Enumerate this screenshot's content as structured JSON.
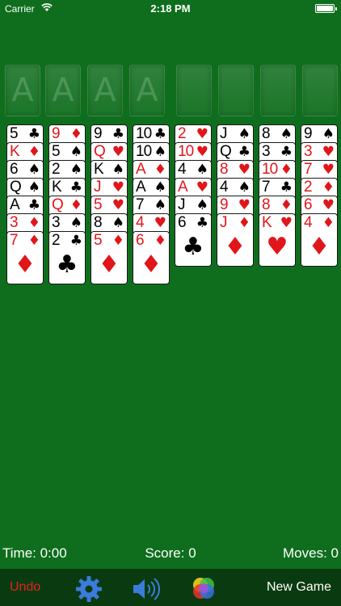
{
  "status_bar": {
    "carrier": "Carrier",
    "time": "2:18 PM"
  },
  "slots": [
    "A",
    "A",
    "A",
    "A",
    "",
    "",
    "",
    ""
  ],
  "columns": [
    [
      {
        "rank": "5",
        "suit": "♣",
        "color": "black"
      },
      {
        "rank": "K",
        "suit": "♦",
        "color": "red"
      },
      {
        "rank": "6",
        "suit": "♠",
        "color": "black"
      },
      {
        "rank": "Q",
        "suit": "♠",
        "color": "black"
      },
      {
        "rank": "A",
        "suit": "♣",
        "color": "black"
      },
      {
        "rank": "3",
        "suit": "♦",
        "color": "red"
      },
      {
        "rank": "7",
        "suit": "♦",
        "color": "red"
      }
    ],
    [
      {
        "rank": "9",
        "suit": "♦",
        "color": "red"
      },
      {
        "rank": "5",
        "suit": "♠",
        "color": "black"
      },
      {
        "rank": "2",
        "suit": "♠",
        "color": "black"
      },
      {
        "rank": "K",
        "suit": "♣",
        "color": "black"
      },
      {
        "rank": "Q",
        "suit": "♦",
        "color": "red"
      },
      {
        "rank": "3",
        "suit": "♠",
        "color": "black"
      },
      {
        "rank": "2",
        "suit": "♣",
        "color": "black"
      }
    ],
    [
      {
        "rank": "9",
        "suit": "♣",
        "color": "black"
      },
      {
        "rank": "Q",
        "suit": "♥",
        "color": "red"
      },
      {
        "rank": "K",
        "suit": "♠",
        "color": "black"
      },
      {
        "rank": "J",
        "suit": "♥",
        "color": "red"
      },
      {
        "rank": "5",
        "suit": "♥",
        "color": "red"
      },
      {
        "rank": "8",
        "suit": "♠",
        "color": "black"
      },
      {
        "rank": "5",
        "suit": "♦",
        "color": "red"
      }
    ],
    [
      {
        "rank": "10",
        "suit": "♣",
        "color": "black"
      },
      {
        "rank": "10",
        "suit": "♠",
        "color": "black"
      },
      {
        "rank": "A",
        "suit": "♦",
        "color": "red"
      },
      {
        "rank": "A",
        "suit": "♠",
        "color": "black"
      },
      {
        "rank": "7",
        "suit": "♠",
        "color": "black"
      },
      {
        "rank": "4",
        "suit": "♥",
        "color": "red"
      },
      {
        "rank": "6",
        "suit": "♦",
        "color": "red"
      }
    ],
    [
      {
        "rank": "2",
        "suit": "♥",
        "color": "red"
      },
      {
        "rank": "10",
        "suit": "♥",
        "color": "red"
      },
      {
        "rank": "4",
        "suit": "♠",
        "color": "black"
      },
      {
        "rank": "A",
        "suit": "♥",
        "color": "red"
      },
      {
        "rank": "J",
        "suit": "♠",
        "color": "black"
      },
      {
        "rank": "6",
        "suit": "♣",
        "color": "black"
      }
    ],
    [
      {
        "rank": "J",
        "suit": "♠",
        "color": "black"
      },
      {
        "rank": "Q",
        "suit": "♣",
        "color": "black"
      },
      {
        "rank": "8",
        "suit": "♥",
        "color": "red"
      },
      {
        "rank": "4",
        "suit": "♠",
        "color": "black"
      },
      {
        "rank": "9",
        "suit": "♥",
        "color": "red"
      },
      {
        "rank": "J",
        "suit": "♦",
        "color": "red"
      }
    ],
    [
      {
        "rank": "8",
        "suit": "♠",
        "color": "black"
      },
      {
        "rank": "3",
        "suit": "♣",
        "color": "black"
      },
      {
        "rank": "10",
        "suit": "♦",
        "color": "red"
      },
      {
        "rank": "7",
        "suit": "♣",
        "color": "black"
      },
      {
        "rank": "8",
        "suit": "♦",
        "color": "red"
      },
      {
        "rank": "K",
        "suit": "♥",
        "color": "red"
      }
    ],
    [
      {
        "rank": "9",
        "suit": "♠",
        "color": "black"
      },
      {
        "rank": "3",
        "suit": "♥",
        "color": "red"
      },
      {
        "rank": "7",
        "suit": "♥",
        "color": "red"
      },
      {
        "rank": "2",
        "suit": "♦",
        "color": "red"
      },
      {
        "rank": "6",
        "suit": "♥",
        "color": "red"
      },
      {
        "rank": "4",
        "suit": "♦",
        "color": "red"
      }
    ]
  ],
  "score_bar": {
    "time": "Time: 0:00",
    "score": "Score: 0",
    "moves": "Moves: 0"
  },
  "toolbar": {
    "undo": "Undo",
    "new_game": "New Game",
    "icons": [
      "gear-icon",
      "speaker-icon",
      "color-circles-icon"
    ]
  },
  "colors": {
    "felt": "#0f6e1d",
    "toolbar": "#0a3b10",
    "red_suit": "#e0161b",
    "undo": "#e8201f",
    "gear": "#3a7bdc"
  }
}
